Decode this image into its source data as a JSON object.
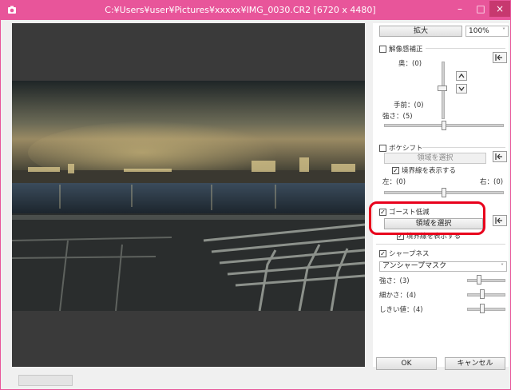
{
  "window": {
    "title": "C:¥Users¥user¥Pictures¥xxxxx¥IMG_0030.CR2 [6720 x 4480]",
    "minimize": "–",
    "maximize": "□",
    "close": "×"
  },
  "panel": {
    "zoom_button": "拡大",
    "zoom_value": "100%",
    "resolution_correction": {
      "label": "解像感補正",
      "back_label": "奥：(0)",
      "front_label": "手前：(0)",
      "strength_label": "強さ：(5)",
      "checked": false
    },
    "bokeh_shift": {
      "label": "ボケシフト",
      "select_area": "領域を選択",
      "show_boundary": "境界線を表示する",
      "show_boundary_checked": true,
      "left_label": "左：(0)",
      "right_label": "右：(0)",
      "checked": false
    },
    "ghost_reduction": {
      "label": "ゴースト低減",
      "select_area": "領域を選択",
      "show_boundary": "境界線を表示する",
      "show_boundary_checked": true,
      "checked": true
    },
    "sharpness": {
      "label": "シャープネス",
      "checked": true,
      "mode": "アンシャープマスク",
      "strength_label": "強さ：(3)",
      "fineness_label": "細かさ：(4)",
      "threshold_label": "しきい値：(4)"
    },
    "ok": "OK",
    "cancel": "キャンセル"
  },
  "colors": {
    "titlebar": "#e8559a",
    "highlight": "#e8001c"
  }
}
